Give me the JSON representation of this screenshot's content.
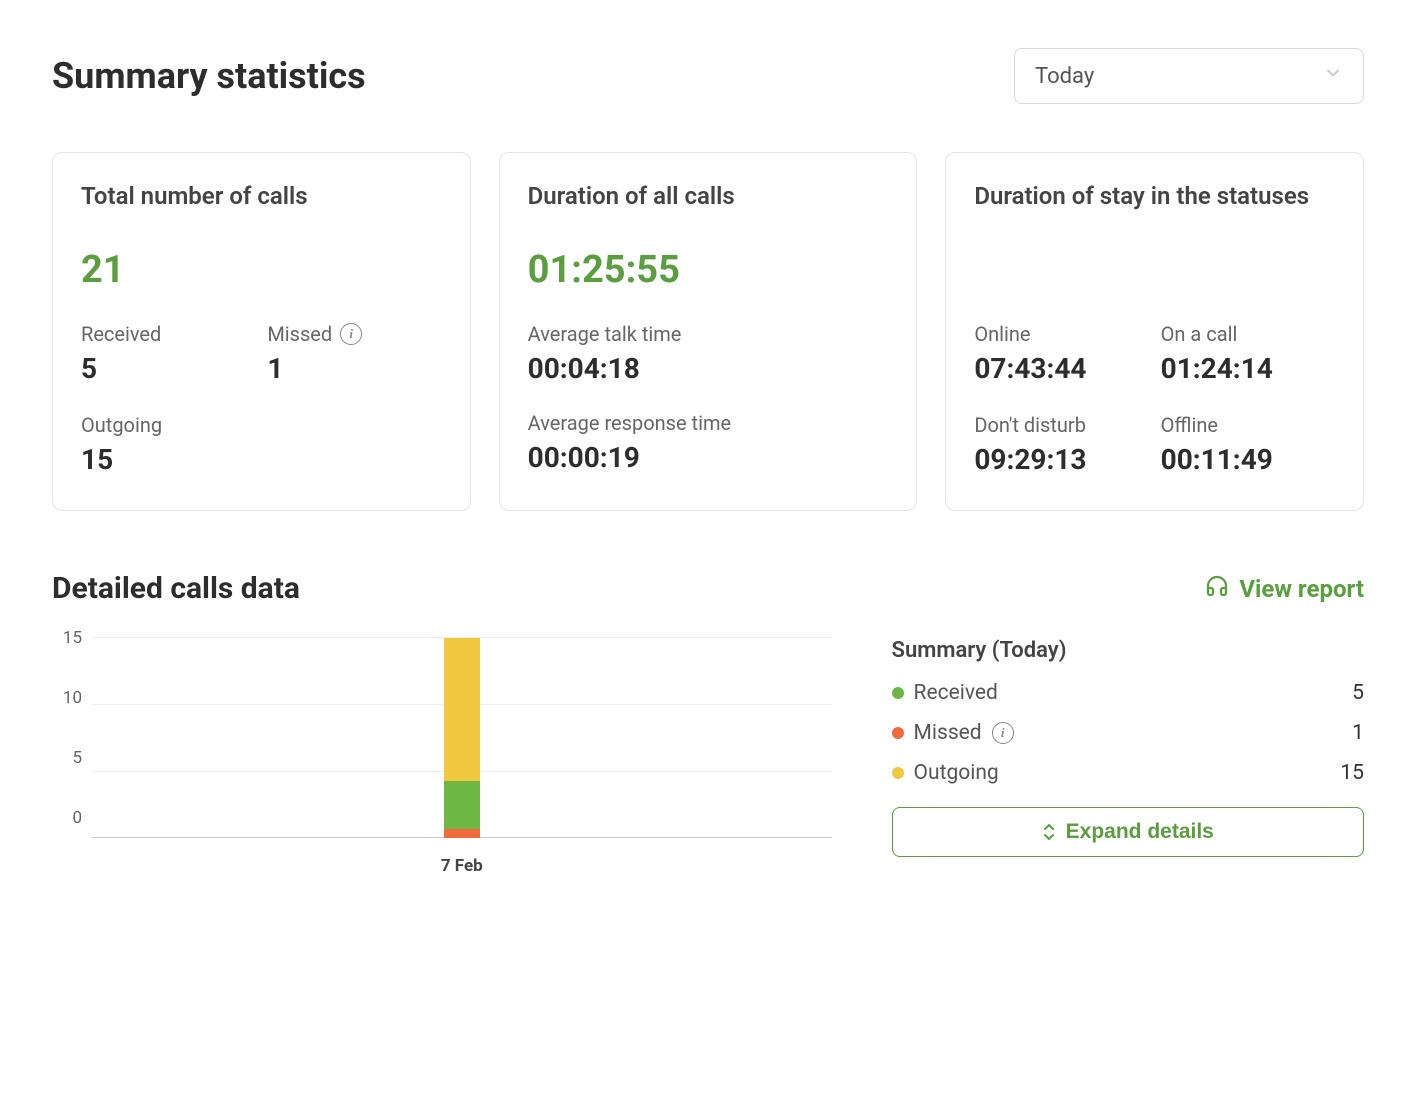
{
  "header": {
    "title": "Summary statistics",
    "period_selected": "Today"
  },
  "cards": {
    "total_calls": {
      "title": "Total number of calls",
      "total": "21",
      "received_label": "Received",
      "received_value": "5",
      "missed_label": "Missed",
      "missed_value": "1",
      "outgoing_label": "Outgoing",
      "outgoing_value": "15"
    },
    "duration": {
      "title": "Duration of all calls",
      "total": "01:25:55",
      "avg_talk_label": "Average talk time",
      "avg_talk_value": "00:04:18",
      "avg_resp_label": "Average response time",
      "avg_resp_value": "00:00:19"
    },
    "statuses": {
      "title": "Duration of stay in the statuses",
      "online_label": "Online",
      "online_value": "07:43:44",
      "on_call_label": "On a call",
      "on_call_value": "01:24:14",
      "dnd_label": "Don't disturb",
      "dnd_value": "09:29:13",
      "offline_label": "Offline",
      "offline_value": "00:11:49"
    }
  },
  "details": {
    "section_title": "Detailed calls data",
    "view_report_label": "View report",
    "expand_label": "Expand details",
    "summary_title": "Summary (Today)",
    "legend": {
      "received": {
        "label": "Received",
        "value": "5",
        "color": "#6db744"
      },
      "missed": {
        "label": "Missed",
        "value": "1",
        "color": "#f26a3b"
      },
      "outgoing": {
        "label": "Outgoing",
        "value": "15",
        "color": "#f2c83f"
      }
    }
  },
  "chart_data": {
    "type": "bar",
    "categories": [
      "7 Feb"
    ],
    "series": [
      {
        "name": "Missed",
        "values": [
          1
        ],
        "color": "#f26a3b"
      },
      {
        "name": "Received",
        "values": [
          5
        ],
        "color": "#6db744"
      },
      {
        "name": "Outgoing",
        "values": [
          15
        ],
        "color": "#f2c83f"
      }
    ],
    "yticks": [
      0,
      5,
      10,
      15
    ],
    "ylim": [
      0,
      15
    ],
    "stacked": true,
    "xlabel": "",
    "ylabel": "",
    "title": ""
  },
  "colors": {
    "accent_green": "#5a9e3f"
  }
}
